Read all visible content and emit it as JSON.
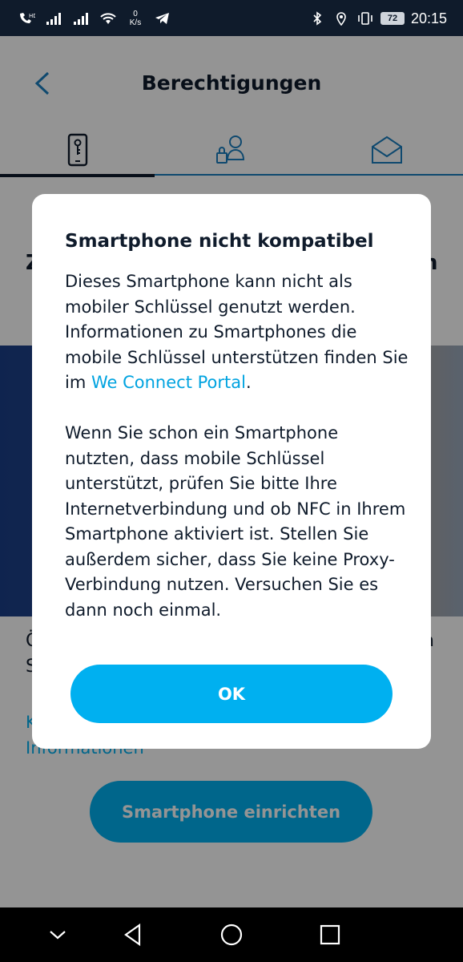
{
  "status_bar": {
    "speed_value": "0",
    "speed_unit": "K/s",
    "battery": "72",
    "time": "20:15"
  },
  "header": {
    "title": "Berechtigungen"
  },
  "tabs": [
    {
      "icon": "smartphone-key-icon",
      "active": true
    },
    {
      "icon": "user-lock-icon",
      "active": false
    },
    {
      "icon": "envelope-icon",
      "active": false
    }
  ],
  "background": {
    "heading_left_fragment": "Z",
    "heading_right_fragment": "n",
    "text_left_fragment_1": "Ö",
    "text_left_fragment_2": "S",
    "text_right_fragment": "n",
    "link_fragment_1": "K",
    "link_fragment_2": "Informationen",
    "setup_button": "Smartphone einrichten"
  },
  "dialog": {
    "title": "Smartphone nicht kompatibel",
    "para1_before_link": "Dieses Smartphone kann nicht als mobiler Schlüssel genutzt werden. Informationen zu Smartphones die mobile Schlüssel unterstützen finden Sie im ",
    "para1_link": "We Connect Portal",
    "para1_after_link": ".",
    "para2": "Wenn Sie schon ein Smartphone nutzten, dass mobile Schlüssel unterstützt, prüfen Sie bitte Ihre Internetverbindung und ob NFC in Ihrem Smartphone aktiviert ist. Stellen Sie außerdem sicher, dass Sie keine Proxy-Verbindung nutzen. Versuchen Sie es dann noch einmal.",
    "ok_label": "OK"
  },
  "colors": {
    "accent": "#00b0f0",
    "text_dark": "#0f1b2b",
    "link": "#00a3e0"
  }
}
